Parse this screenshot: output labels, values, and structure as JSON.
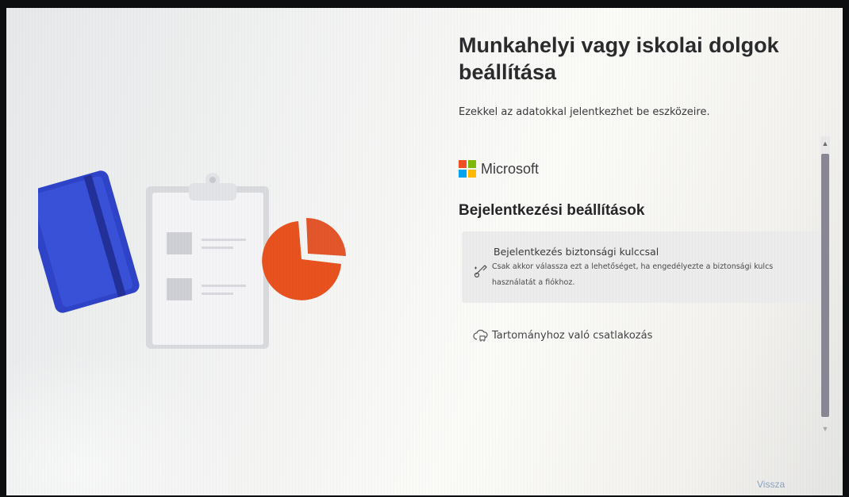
{
  "page": {
    "title": "Munkahelyi vagy iskolai dolgok beállítása",
    "subtitle": "Ezekkel az adatokkal jelentkezhet be eszközeire."
  },
  "brand": {
    "name": "Microsoft",
    "logo_colors": [
      "#f25022",
      "#7fba00",
      "#00a4ef",
      "#ffb900"
    ]
  },
  "section": {
    "heading": "Bejelentkezési beállítások"
  },
  "options": [
    {
      "icon": "security-key-icon",
      "title": "Bejelentkezés biztonsági kulccsal",
      "description": "Csak akkor válassza ezt a lehetőséget, ha engedélyezte a biztonsági kulcs használatát a fiókhoz."
    },
    {
      "icon": "domain-join-icon",
      "title": "Tartományhoz való csatlakozás"
    }
  ],
  "footer": {
    "back_label": "Vissza"
  },
  "colors": {
    "accent_link": "#8aa4c6",
    "notebook": "#2f43c9",
    "pie": "#e8521f",
    "clipboard": "#dedfe3"
  }
}
